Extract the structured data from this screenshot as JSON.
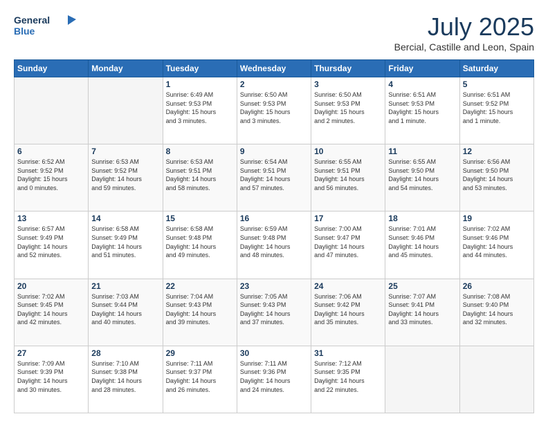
{
  "logo": {
    "line1": "General",
    "line2": "Blue"
  },
  "header": {
    "title": "July 2025",
    "subtitle": "Bercial, Castille and Leon, Spain"
  },
  "weekdays": [
    "Sunday",
    "Monday",
    "Tuesday",
    "Wednesday",
    "Thursday",
    "Friday",
    "Saturday"
  ],
  "weeks": [
    [
      {
        "day": "",
        "info": ""
      },
      {
        "day": "",
        "info": ""
      },
      {
        "day": "1",
        "info": "Sunrise: 6:49 AM\nSunset: 9:53 PM\nDaylight: 15 hours\nand 3 minutes."
      },
      {
        "day": "2",
        "info": "Sunrise: 6:50 AM\nSunset: 9:53 PM\nDaylight: 15 hours\nand 3 minutes."
      },
      {
        "day": "3",
        "info": "Sunrise: 6:50 AM\nSunset: 9:53 PM\nDaylight: 15 hours\nand 2 minutes."
      },
      {
        "day": "4",
        "info": "Sunrise: 6:51 AM\nSunset: 9:53 PM\nDaylight: 15 hours\nand 1 minute."
      },
      {
        "day": "5",
        "info": "Sunrise: 6:51 AM\nSunset: 9:52 PM\nDaylight: 15 hours\nand 1 minute."
      }
    ],
    [
      {
        "day": "6",
        "info": "Sunrise: 6:52 AM\nSunset: 9:52 PM\nDaylight: 15 hours\nand 0 minutes."
      },
      {
        "day": "7",
        "info": "Sunrise: 6:53 AM\nSunset: 9:52 PM\nDaylight: 14 hours\nand 59 minutes."
      },
      {
        "day": "8",
        "info": "Sunrise: 6:53 AM\nSunset: 9:51 PM\nDaylight: 14 hours\nand 58 minutes."
      },
      {
        "day": "9",
        "info": "Sunrise: 6:54 AM\nSunset: 9:51 PM\nDaylight: 14 hours\nand 57 minutes."
      },
      {
        "day": "10",
        "info": "Sunrise: 6:55 AM\nSunset: 9:51 PM\nDaylight: 14 hours\nand 56 minutes."
      },
      {
        "day": "11",
        "info": "Sunrise: 6:55 AM\nSunset: 9:50 PM\nDaylight: 14 hours\nand 54 minutes."
      },
      {
        "day": "12",
        "info": "Sunrise: 6:56 AM\nSunset: 9:50 PM\nDaylight: 14 hours\nand 53 minutes."
      }
    ],
    [
      {
        "day": "13",
        "info": "Sunrise: 6:57 AM\nSunset: 9:49 PM\nDaylight: 14 hours\nand 52 minutes."
      },
      {
        "day": "14",
        "info": "Sunrise: 6:58 AM\nSunset: 9:49 PM\nDaylight: 14 hours\nand 51 minutes."
      },
      {
        "day": "15",
        "info": "Sunrise: 6:58 AM\nSunset: 9:48 PM\nDaylight: 14 hours\nand 49 minutes."
      },
      {
        "day": "16",
        "info": "Sunrise: 6:59 AM\nSunset: 9:48 PM\nDaylight: 14 hours\nand 48 minutes."
      },
      {
        "day": "17",
        "info": "Sunrise: 7:00 AM\nSunset: 9:47 PM\nDaylight: 14 hours\nand 47 minutes."
      },
      {
        "day": "18",
        "info": "Sunrise: 7:01 AM\nSunset: 9:46 PM\nDaylight: 14 hours\nand 45 minutes."
      },
      {
        "day": "19",
        "info": "Sunrise: 7:02 AM\nSunset: 9:46 PM\nDaylight: 14 hours\nand 44 minutes."
      }
    ],
    [
      {
        "day": "20",
        "info": "Sunrise: 7:02 AM\nSunset: 9:45 PM\nDaylight: 14 hours\nand 42 minutes."
      },
      {
        "day": "21",
        "info": "Sunrise: 7:03 AM\nSunset: 9:44 PM\nDaylight: 14 hours\nand 40 minutes."
      },
      {
        "day": "22",
        "info": "Sunrise: 7:04 AM\nSunset: 9:43 PM\nDaylight: 14 hours\nand 39 minutes."
      },
      {
        "day": "23",
        "info": "Sunrise: 7:05 AM\nSunset: 9:43 PM\nDaylight: 14 hours\nand 37 minutes."
      },
      {
        "day": "24",
        "info": "Sunrise: 7:06 AM\nSunset: 9:42 PM\nDaylight: 14 hours\nand 35 minutes."
      },
      {
        "day": "25",
        "info": "Sunrise: 7:07 AM\nSunset: 9:41 PM\nDaylight: 14 hours\nand 33 minutes."
      },
      {
        "day": "26",
        "info": "Sunrise: 7:08 AM\nSunset: 9:40 PM\nDaylight: 14 hours\nand 32 minutes."
      }
    ],
    [
      {
        "day": "27",
        "info": "Sunrise: 7:09 AM\nSunset: 9:39 PM\nDaylight: 14 hours\nand 30 minutes."
      },
      {
        "day": "28",
        "info": "Sunrise: 7:10 AM\nSunset: 9:38 PM\nDaylight: 14 hours\nand 28 minutes."
      },
      {
        "day": "29",
        "info": "Sunrise: 7:11 AM\nSunset: 9:37 PM\nDaylight: 14 hours\nand 26 minutes."
      },
      {
        "day": "30",
        "info": "Sunrise: 7:11 AM\nSunset: 9:36 PM\nDaylight: 14 hours\nand 24 minutes."
      },
      {
        "day": "31",
        "info": "Sunrise: 7:12 AM\nSunset: 9:35 PM\nDaylight: 14 hours\nand 22 minutes."
      },
      {
        "day": "",
        "info": ""
      },
      {
        "day": "",
        "info": ""
      }
    ]
  ]
}
